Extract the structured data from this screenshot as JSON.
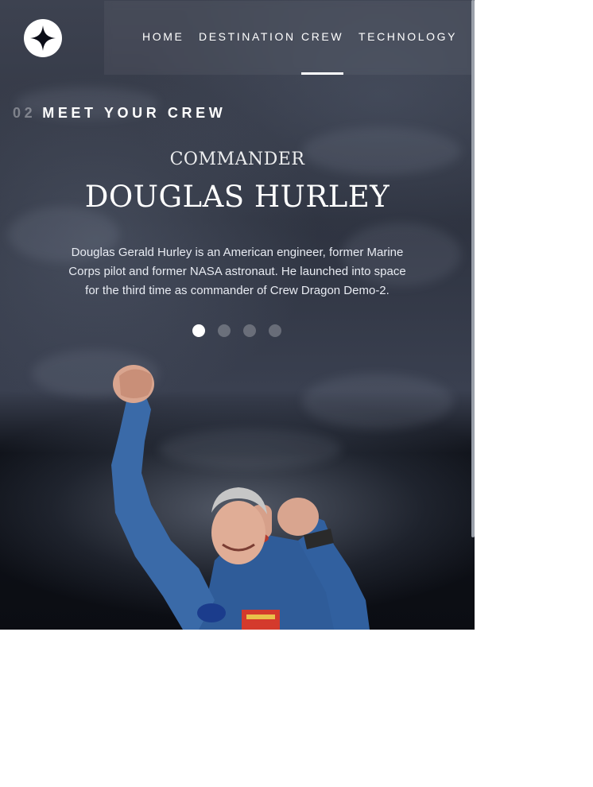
{
  "nav": {
    "items": [
      {
        "label": "HOME"
      },
      {
        "label": "DESTINATION"
      },
      {
        "label": "CREW"
      },
      {
        "label": "TECHNOLOGY"
      }
    ],
    "active": "CREW"
  },
  "section": {
    "number": "02",
    "title": "MEET YOUR CREW"
  },
  "crew": {
    "role": "COMMANDER",
    "name": "DOUGLAS HURLEY",
    "bio": "Douglas Gerald Hurley is an American engineer, former Marine Corps pilot and former NASA astronaut. He launched into space for the third time as commander of Crew Dragon Demo-2."
  },
  "carousel": {
    "count": 4,
    "active_index": 0
  },
  "colors": {
    "background": "#0b0d13",
    "text": "#ffffff",
    "accent": "#ffffff"
  },
  "icons": {
    "logo": "four-point-star-icon"
  }
}
